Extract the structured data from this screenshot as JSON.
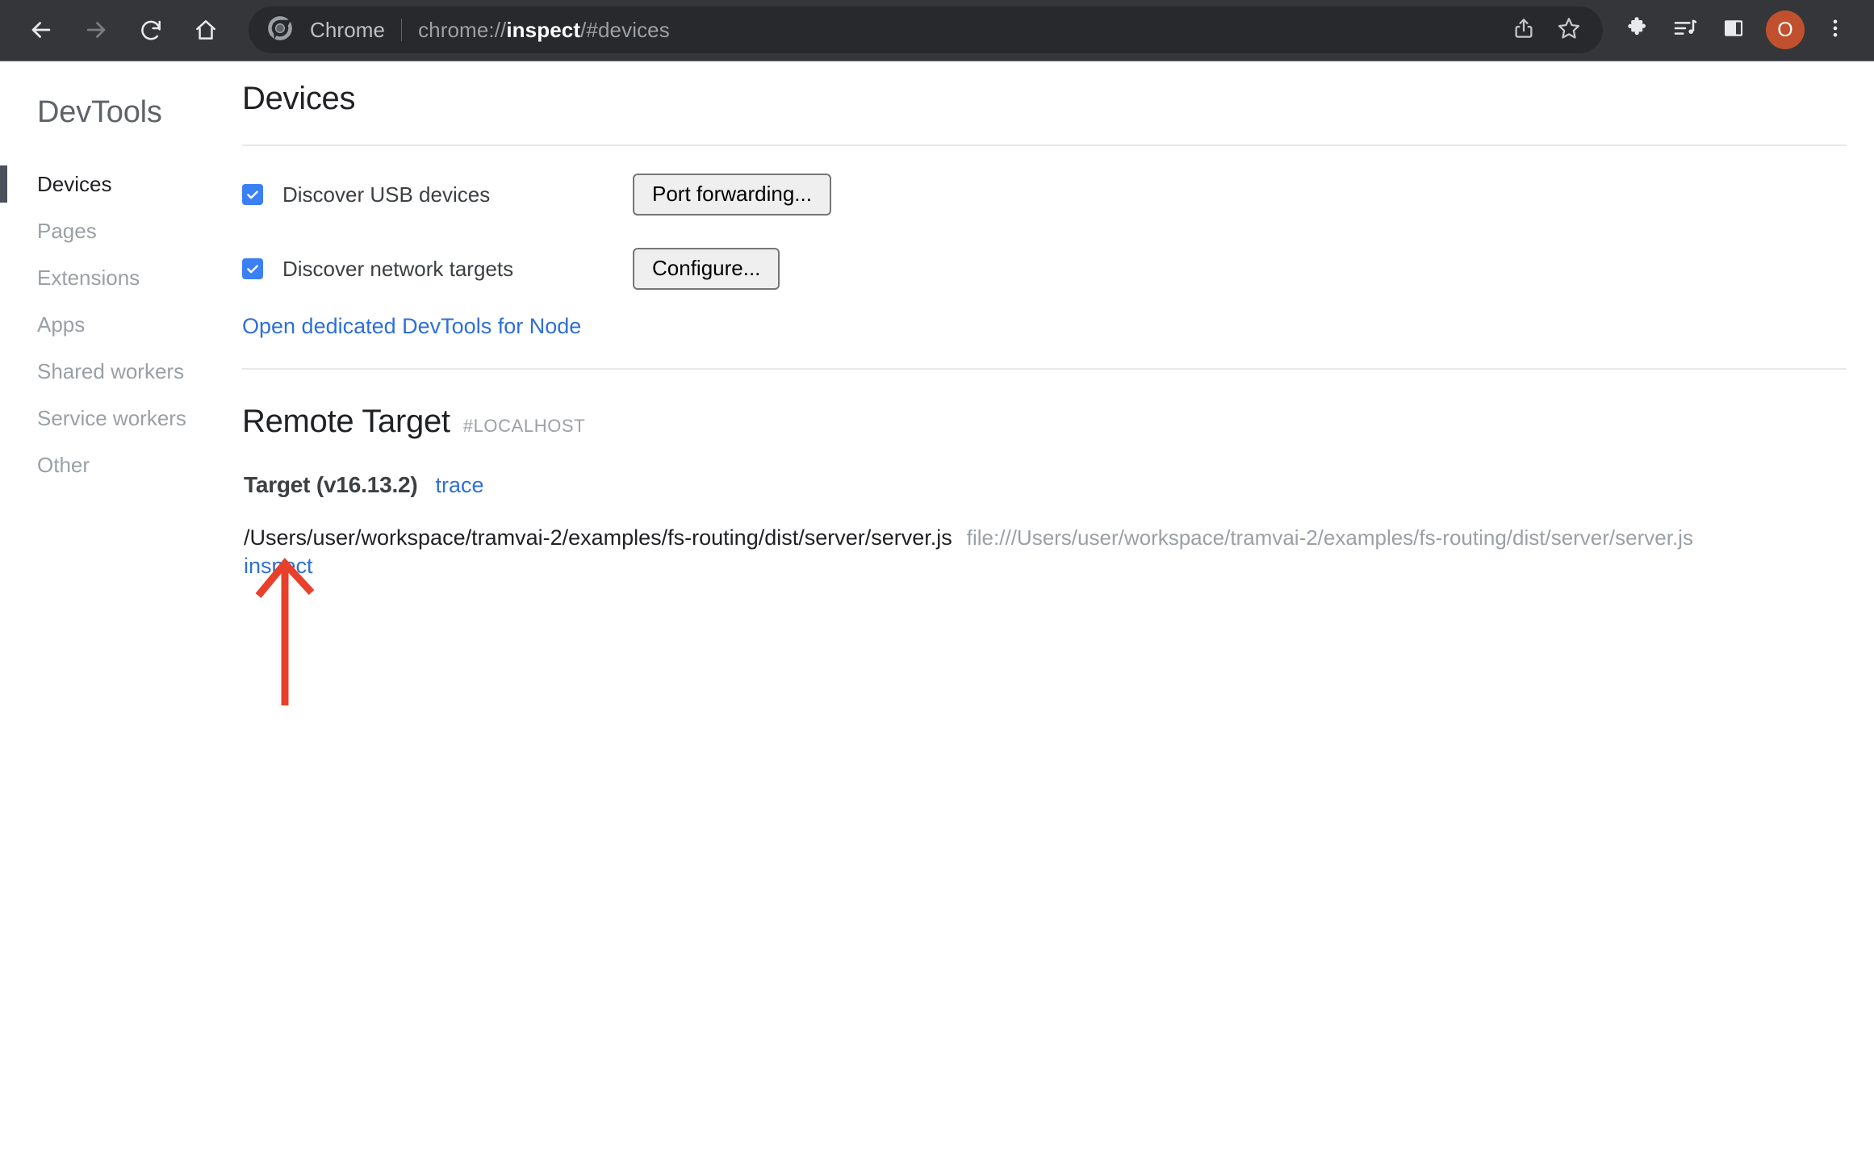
{
  "browser": {
    "nav": {
      "back_icon": "arrow-left-icon",
      "forward_icon": "arrow-right-icon",
      "reload_icon": "reload-icon",
      "home_icon": "home-icon"
    },
    "omnibox": {
      "chip_label": "Chrome",
      "url_prefix": "chrome://",
      "url_emphasis": "inspect",
      "url_suffix": "/#devices",
      "full_url": "chrome://inspect/#devices",
      "share_icon": "share-icon",
      "bookmark_icon": "star-outline-icon"
    },
    "toolbar_actions": {
      "extensions_icon": "puzzle-piece-icon",
      "media_icon": "media-playlist-icon",
      "side_panel_icon": "side-panel-icon",
      "avatar_initial": "O",
      "avatar_color": "#c1502e",
      "menu_icon": "three-dot-menu-icon"
    },
    "colors": {
      "toolbar_bg": "#35363a",
      "omnibox_bg": "#28292c",
      "text_muted": "#9aa0a6"
    }
  },
  "sidebar": {
    "title": "DevTools",
    "active_index": 0,
    "items": [
      {
        "label": "Devices"
      },
      {
        "label": "Pages"
      },
      {
        "label": "Extensions"
      },
      {
        "label": "Apps"
      },
      {
        "label": "Shared workers"
      },
      {
        "label": "Service workers"
      },
      {
        "label": "Other"
      }
    ]
  },
  "main": {
    "devices_heading": "Devices",
    "discovery": {
      "usb": {
        "label": "Discover USB devices",
        "checked": true,
        "button_label": "Port forwarding..."
      },
      "network": {
        "label": "Discover network targets",
        "checked": true,
        "button_label": "Configure..."
      }
    },
    "node_link_label": "Open dedicated DevTools for Node",
    "remote_target": {
      "title": "Remote Target",
      "host": "#LOCALHOST",
      "target_name": "Target (v16.13.2)",
      "trace_label": "trace",
      "path": "/Users/user/workspace/tramvai-2/examples/fs-routing/dist/server/server.js",
      "url": "file:///Users/user/workspace/tramvai-2/examples/fs-routing/dist/server/server.js",
      "inspect_label": "inspect"
    }
  },
  "annotation": {
    "arrow_icon": "up-arrow-annotation",
    "color": "#e8402a",
    "points_at": "inspect"
  }
}
